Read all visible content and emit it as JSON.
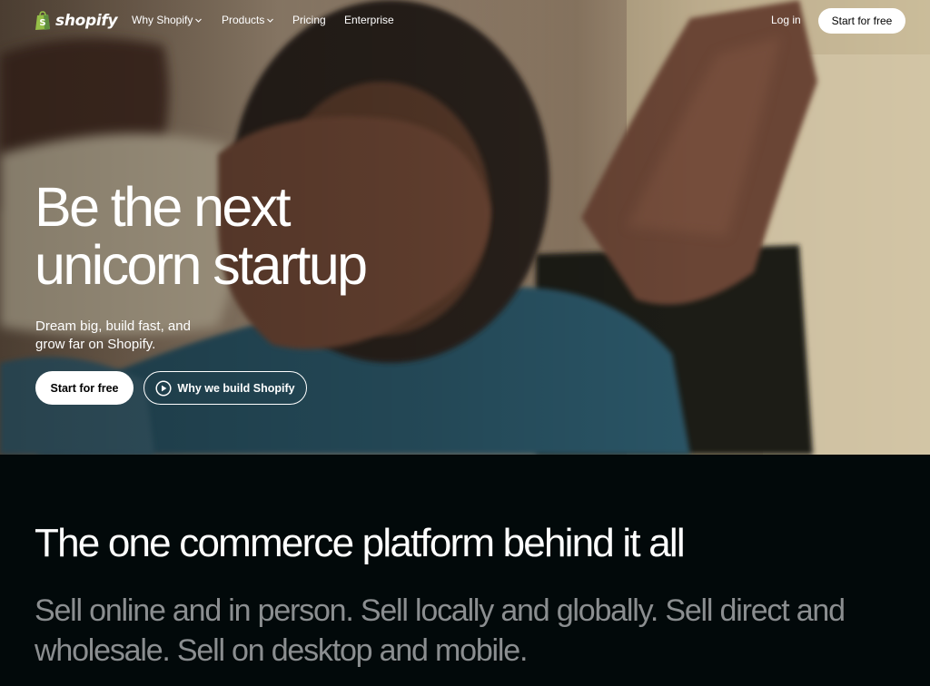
{
  "brand": {
    "name": "shopify",
    "accent": "#95bf47"
  },
  "nav": {
    "items": [
      {
        "label": "Why Shopify",
        "has_dropdown": true
      },
      {
        "label": "Products",
        "has_dropdown": true
      },
      {
        "label": "Pricing",
        "has_dropdown": false
      },
      {
        "label": "Enterprise",
        "has_dropdown": false
      }
    ],
    "login_label": "Log in",
    "cta_label": "Start for free"
  },
  "hero": {
    "title_line1": "Be the next",
    "title_line2": "unicorn startup",
    "subtitle_line1": "Dream big, build fast, and",
    "subtitle_line2": "grow far on Shopify.",
    "primary_cta": "Start for free",
    "secondary_cta": "Why we build Shopify",
    "secondary_icon": "play-circle-icon"
  },
  "platform": {
    "title": "The one commerce platform behind it all",
    "subtitle_line1": "Sell online and in person. Sell locally and globally. Sell direct and",
    "subtitle_line2": "wholesale. Sell on desktop and mobile."
  },
  "colors": {
    "dark_background": "#02090a",
    "subtitle_gray": "#8b8e90"
  }
}
